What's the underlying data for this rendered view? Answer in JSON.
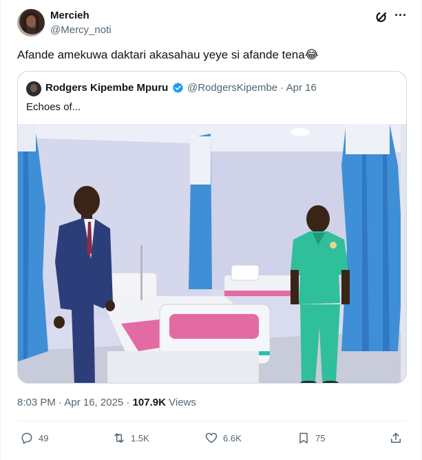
{
  "author": {
    "name": "Mercieh",
    "handle": "@Mercy_noti"
  },
  "tweet": {
    "text": "Afande amekuwa daktari akasahau yeye si afande tena😂"
  },
  "quote": {
    "name": "Rodgers Kipembe Mpuru",
    "handle_date": "@RodgersKipembe · Apr 16",
    "text": "Echoes of..."
  },
  "meta": {
    "time_date": "8:03 PM · Apr 16, 2025 · ",
    "views_count": "107.9K",
    "views_label": " Views"
  },
  "actions": {
    "replies": "49",
    "reposts": "1.5K",
    "likes": "6.6K",
    "bookmarks": "75"
  },
  "icons": [
    "grok-icon",
    "more-icon",
    "verified-icon",
    "reply-icon",
    "repost-icon",
    "like-icon",
    "bookmark-icon",
    "share-icon"
  ],
  "colors": {
    "verified": "#1d9bf0",
    "secondary_text": "#536471",
    "scrubs": "#2fbf9a",
    "curtain": "#3f8fd6",
    "suit": "#2c3e7a"
  }
}
